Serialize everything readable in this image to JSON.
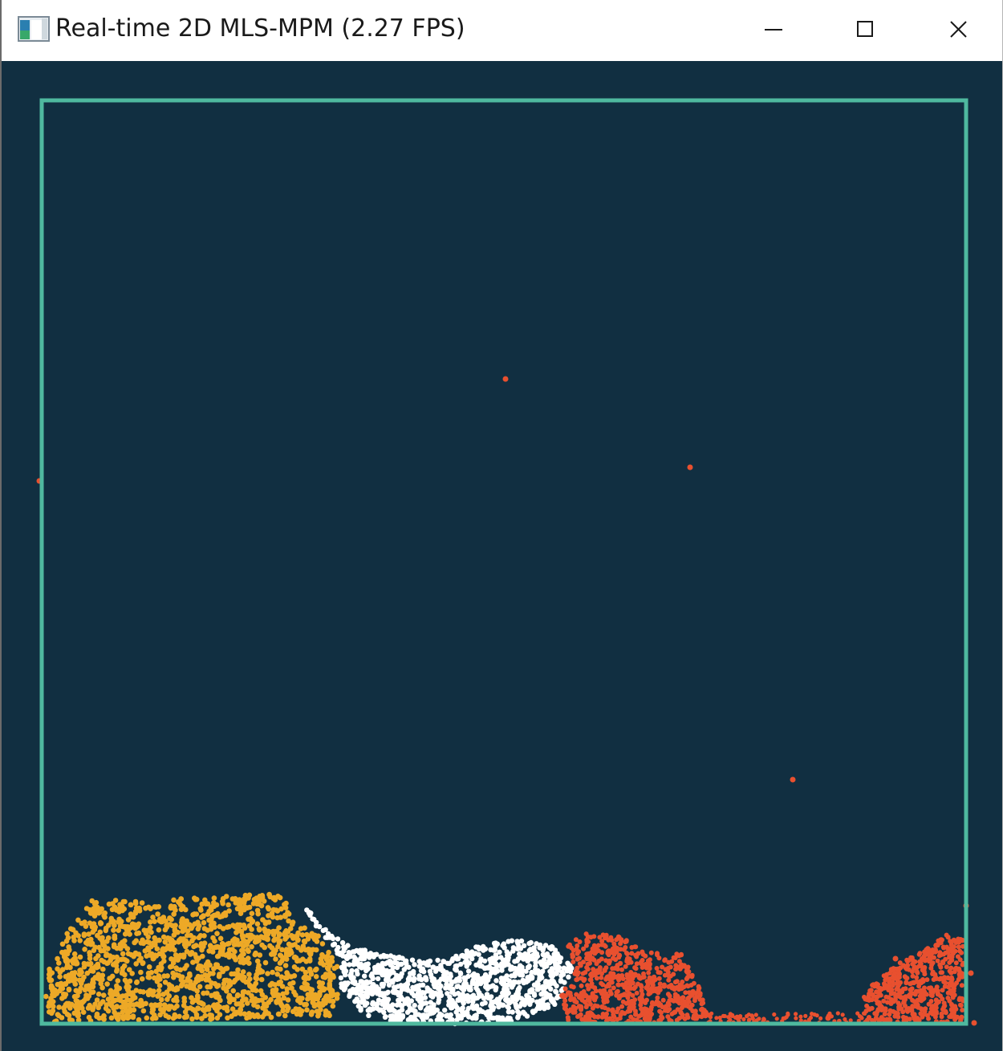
{
  "window": {
    "title": "Real-time 2D MLS-MPM (2.27 FPS)",
    "icon": "app-window-icon",
    "controls": [
      "minimize-icon",
      "maximize-icon",
      "close-icon"
    ]
  },
  "simulation": {
    "background_color": "#112f41",
    "boundary_color": "#4fb99f",
    "materials": [
      {
        "color": "#eda927"
      },
      {
        "color": "#ffffff"
      },
      {
        "color": "#e8502f"
      }
    ]
  }
}
